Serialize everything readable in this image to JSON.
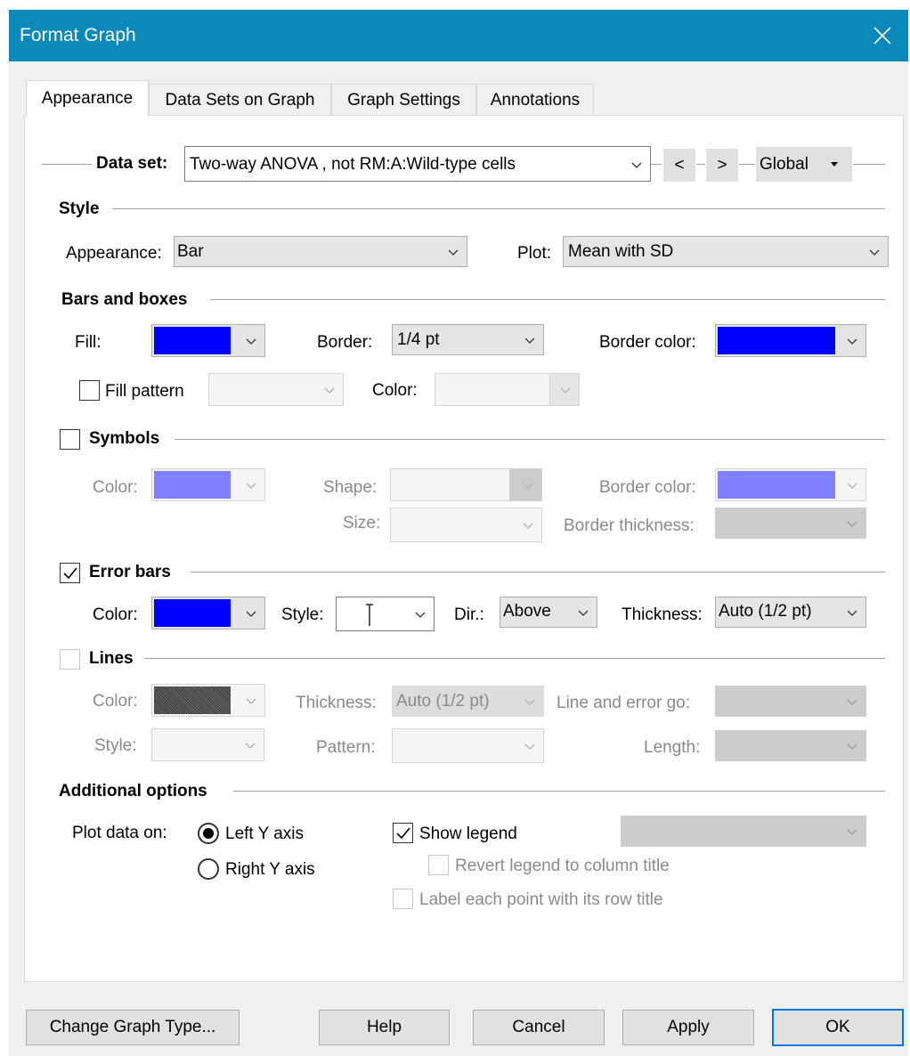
{
  "window": {
    "title": "Format Graph"
  },
  "tabs": [
    {
      "label": "Appearance"
    },
    {
      "label": "Data Sets on Graph"
    },
    {
      "label": "Graph Settings"
    },
    {
      "label": "Annotations"
    }
  ],
  "dataset": {
    "label": "Data set:",
    "value": "Two-way ANOVA , not RM:A:Wild-type cells",
    "prev": "<",
    "next": ">",
    "scope": "Global"
  },
  "style": {
    "section": "Style",
    "appearance_label": "Appearance:",
    "appearance_value": "Bar",
    "plot_label": "Plot:",
    "plot_value": "Mean with SD"
  },
  "bars": {
    "section": "Bars and boxes",
    "fill_label": "Fill:",
    "fill_color": "#0000ff",
    "border_label": "Border:",
    "border_value": "1/4 pt",
    "border_color_label": "Border color:",
    "border_color": "#0000ff",
    "fill_pattern_label": "Fill pattern",
    "fill_pattern_checked": false,
    "pattern_color_label": "Color:"
  },
  "symbols": {
    "section": "Symbols",
    "checked": false,
    "color_label": "Color:",
    "color": "#8080ff",
    "shape_label": "Shape:",
    "size_label": "Size:",
    "border_color_label": "Border color:",
    "border_color": "#8080ff",
    "border_thickness_label": "Border thickness:"
  },
  "error_bars": {
    "section": "Error bars",
    "checked": true,
    "color_label": "Color:",
    "color": "#0000ff",
    "style_label": "Style:",
    "dir_label": "Dir.:",
    "dir_value": "Above",
    "thickness_label": "Thickness:",
    "thickness_value": "Auto (1/2 pt)"
  },
  "lines": {
    "section": "Lines",
    "checked": false,
    "color_label": "Color:",
    "color": "#404040",
    "thickness_label": "Thickness:",
    "thickness_value": "Auto (1/2 pt)",
    "line_error_label": "Line and error go:",
    "style_label": "Style:",
    "pattern_label": "Pattern:",
    "length_label": "Length:"
  },
  "additional": {
    "section": "Additional options",
    "plot_on_label": "Plot data on:",
    "left_axis": "Left Y axis",
    "right_axis": "Right  Y axis",
    "show_legend": "Show legend",
    "revert_legend": "Revert legend to column title",
    "label_points": "Label each point with its row title"
  },
  "footer": {
    "change_type": "Change Graph Type...",
    "help": "Help",
    "cancel": "Cancel",
    "apply": "Apply",
    "ok": "OK"
  }
}
